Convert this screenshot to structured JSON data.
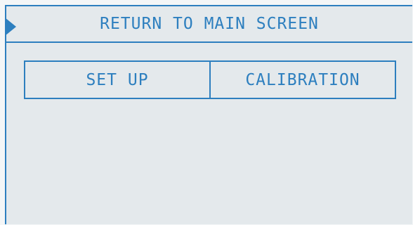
{
  "header": {
    "title": "RETURN TO MAIN SCREEN"
  },
  "menu": {
    "items": [
      {
        "label": "SET UP"
      },
      {
        "label": "CALIBRATION"
      }
    ]
  },
  "colors": {
    "accent": "#2d7fbf",
    "background": "#e4e9ec"
  },
  "icons": {
    "selector": "right-triangle-icon"
  }
}
